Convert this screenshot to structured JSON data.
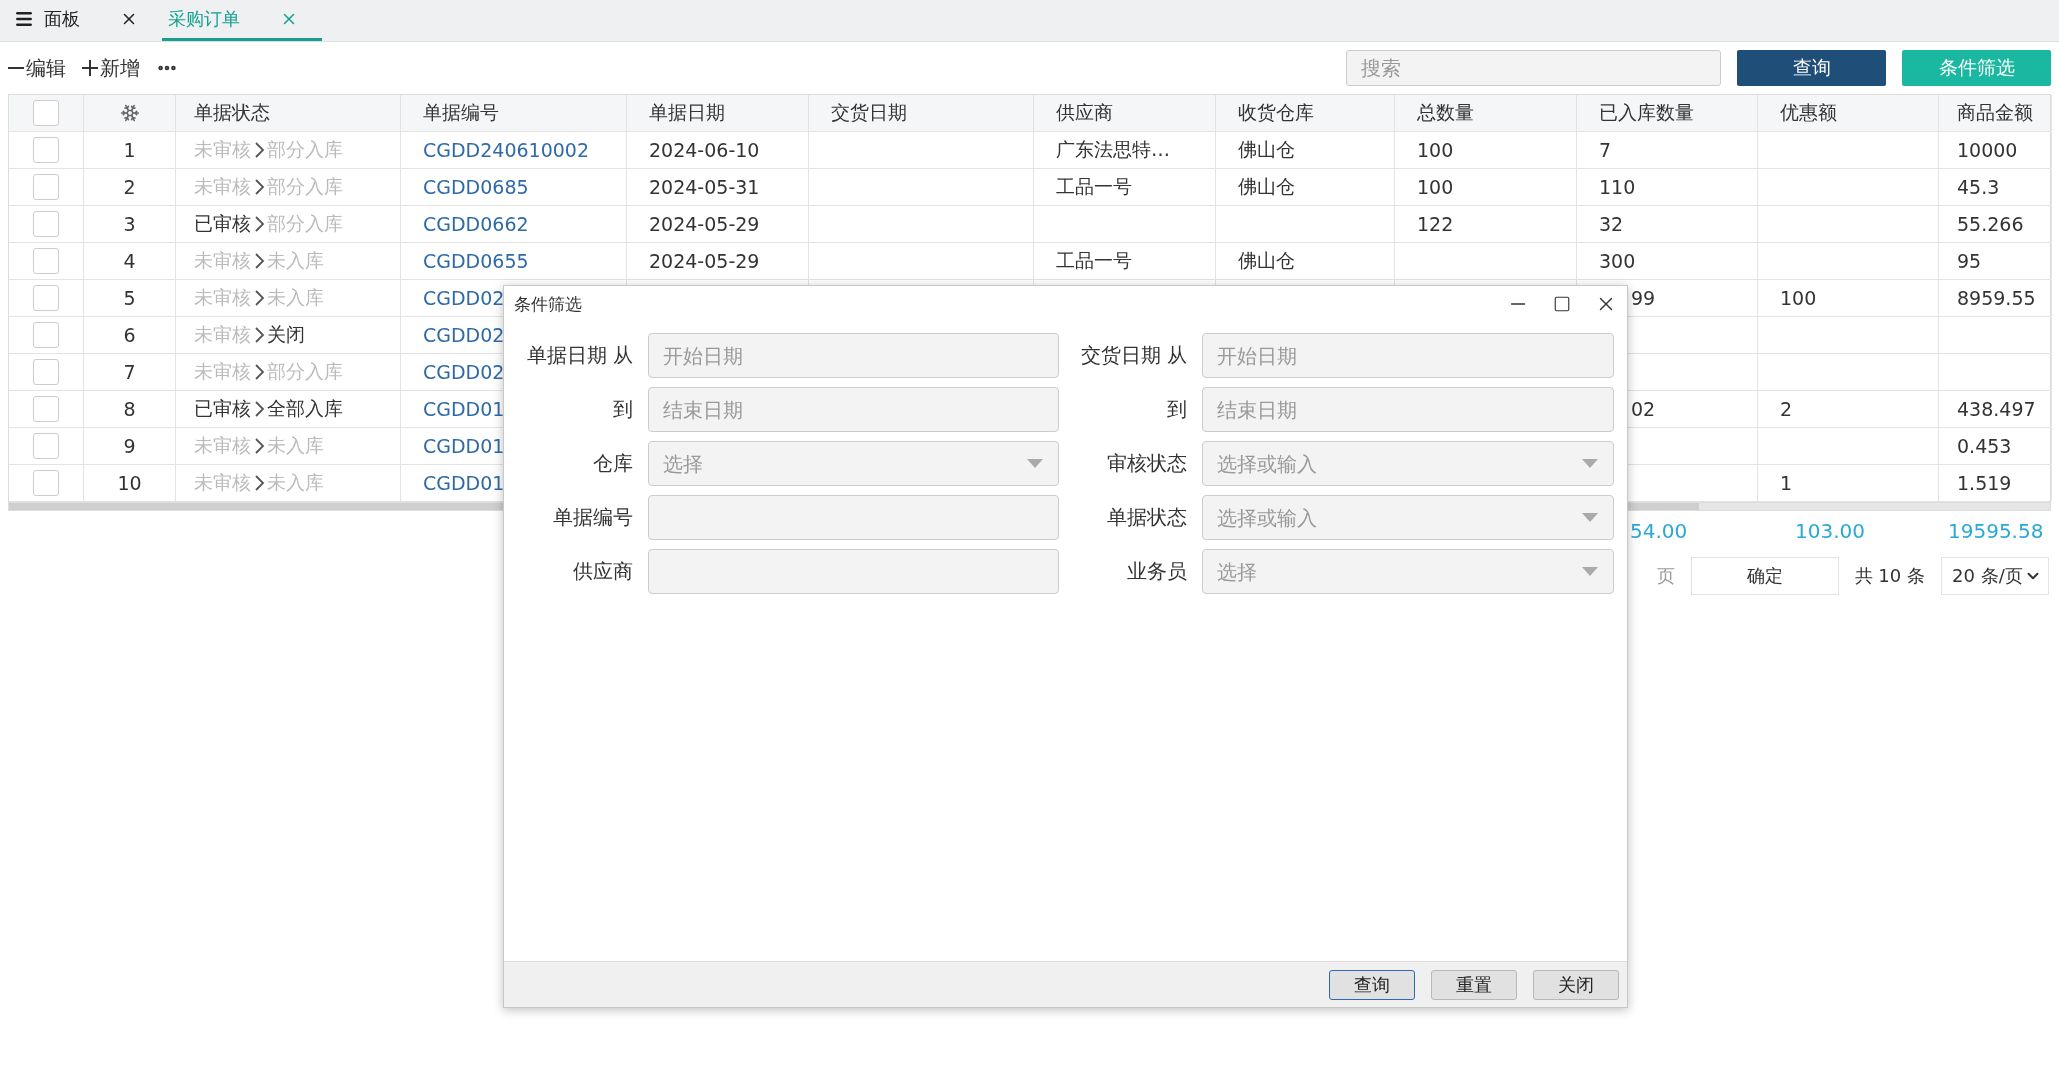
{
  "tabs": [
    {
      "label": "面板",
      "selected": false
    },
    {
      "label": "采购订单",
      "selected": true
    }
  ],
  "toolbar": {
    "actions": [
      {
        "kind": "minus",
        "label": "编辑"
      },
      {
        "kind": "plus",
        "label": "新增"
      }
    ],
    "search": {
      "placeholder": "搜索"
    },
    "query_button": "查询",
    "filter_button": "条件筛选"
  },
  "table": {
    "header_checked": false,
    "status_column": "单据状态",
    "columns": [
      "单据编号",
      "单据日期",
      "交货日期",
      "供应商",
      "收货仓库",
      "总数量",
      "已入库数量",
      "优惠额",
      "商品金额"
    ],
    "rows": [
      {
        "checked": false,
        "no": "1",
        "audit": {
          "label": "未审核",
          "done": false
        },
        "stock": {
          "label": "部分入库",
          "done": false
        },
        "cells": [
          "CGDD240610002",
          "2024-06-10",
          "",
          "广东法思特…",
          "佛山仓",
          "100",
          "7",
          "",
          "10000"
        ]
      },
      {
        "checked": false,
        "no": "2",
        "audit": {
          "label": "未审核",
          "done": false
        },
        "stock": {
          "label": "部分入库",
          "done": false
        },
        "cells": [
          "CGDD0685",
          "2024-05-31",
          "",
          "工品一号",
          "佛山仓",
          "100",
          "110",
          "",
          "45.3"
        ]
      },
      {
        "checked": false,
        "no": "3",
        "audit": {
          "label": "已审核",
          "done": true
        },
        "stock": {
          "label": "部分入库",
          "done": false
        },
        "cells": [
          "CGDD0662",
          "2024-05-29",
          "",
          "",
          "",
          "122",
          "32",
          "",
          "55.266"
        ]
      },
      {
        "checked": false,
        "no": "4",
        "audit": {
          "label": "未审核",
          "done": false
        },
        "stock": {
          "label": "未入库",
          "done": false
        },
        "cells": [
          "CGDD0655",
          "2024-05-29",
          "",
          "工品一号",
          "佛山仓",
          "",
          "300",
          "",
          "95"
        ]
      },
      {
        "checked": false,
        "received_covered": true,
        "no": "5",
        "audit": {
          "label": "未审核",
          "done": false
        },
        "stock": {
          "label": "未入库",
          "done": false
        },
        "cells": [
          "CGDD02",
          "",
          "",
          "",
          "",
          "",
          "99",
          "100",
          "8959.55"
        ]
      },
      {
        "checked": false,
        "no": "6",
        "audit": {
          "label": "未审核",
          "done": false
        },
        "stock": {
          "label": "关闭",
          "done": true
        },
        "cells": [
          "CGDD02",
          "",
          "",
          "",
          "",
          "",
          "",
          "",
          ""
        ]
      },
      {
        "checked": false,
        "no": "7",
        "audit": {
          "label": "未审核",
          "done": false
        },
        "stock": {
          "label": "部分入库",
          "done": false
        },
        "cells": [
          "CGDD02",
          "",
          "",
          "",
          "",
          "",
          "",
          "",
          ""
        ]
      },
      {
        "checked": false,
        "received_covered": true,
        "no": "8",
        "audit": {
          "label": "已审核",
          "done": true
        },
        "stock": {
          "label": "全部入库",
          "done": true
        },
        "cells": [
          "CGDD01",
          "",
          "",
          "",
          "",
          "",
          "02",
          "2",
          "438.497"
        ]
      },
      {
        "checked": false,
        "no": "9",
        "audit": {
          "label": "未审核",
          "done": false
        },
        "stock": {
          "label": "未入库",
          "done": false
        },
        "cells": [
          "CGDD01",
          "",
          "",
          "",
          "",
          "",
          "",
          "",
          "0.453"
        ]
      },
      {
        "checked": false,
        "no": "10",
        "audit": {
          "label": "未审核",
          "done": false
        },
        "stock": {
          "label": "未入库",
          "done": false
        },
        "cells": [
          "CGDD01",
          "",
          "",
          "",
          "",
          "",
          "",
          "1",
          "1.519"
        ]
      }
    ],
    "totals": [
      "54.00",
      "103.00",
      "19595.58"
    ]
  },
  "pagination": {
    "page_unit": "页",
    "confirm": "确定",
    "total": "共 10 条",
    "page_size": "20 条/页"
  },
  "dialog": {
    "title": "条件筛选",
    "fields": [
      {
        "label": "单据日期 从",
        "placeholder": "开始日期",
        "kind": "text"
      },
      {
        "label": "交货日期 从",
        "placeholder": "开始日期",
        "kind": "text"
      },
      {
        "label": "到",
        "placeholder": "结束日期",
        "kind": "text"
      },
      {
        "label": "到",
        "placeholder": "结束日期",
        "kind": "text"
      },
      {
        "label": "仓库",
        "placeholder": "选择",
        "kind": "select"
      },
      {
        "label": "审核状态",
        "placeholder": "选择或输入",
        "kind": "select"
      },
      {
        "label": "单据编号",
        "kind": "text"
      },
      {
        "label": "单据状态",
        "placeholder": "选择或输入",
        "kind": "select"
      },
      {
        "label": "供应商",
        "kind": "text"
      },
      {
        "label": "业务员",
        "placeholder": "选择",
        "kind": "select"
      }
    ],
    "buttons": [
      {
        "label": "查询",
        "focused": true
      },
      {
        "label": "重置",
        "focused": false
      },
      {
        "label": "关闭",
        "focused": false
      }
    ]
  }
}
